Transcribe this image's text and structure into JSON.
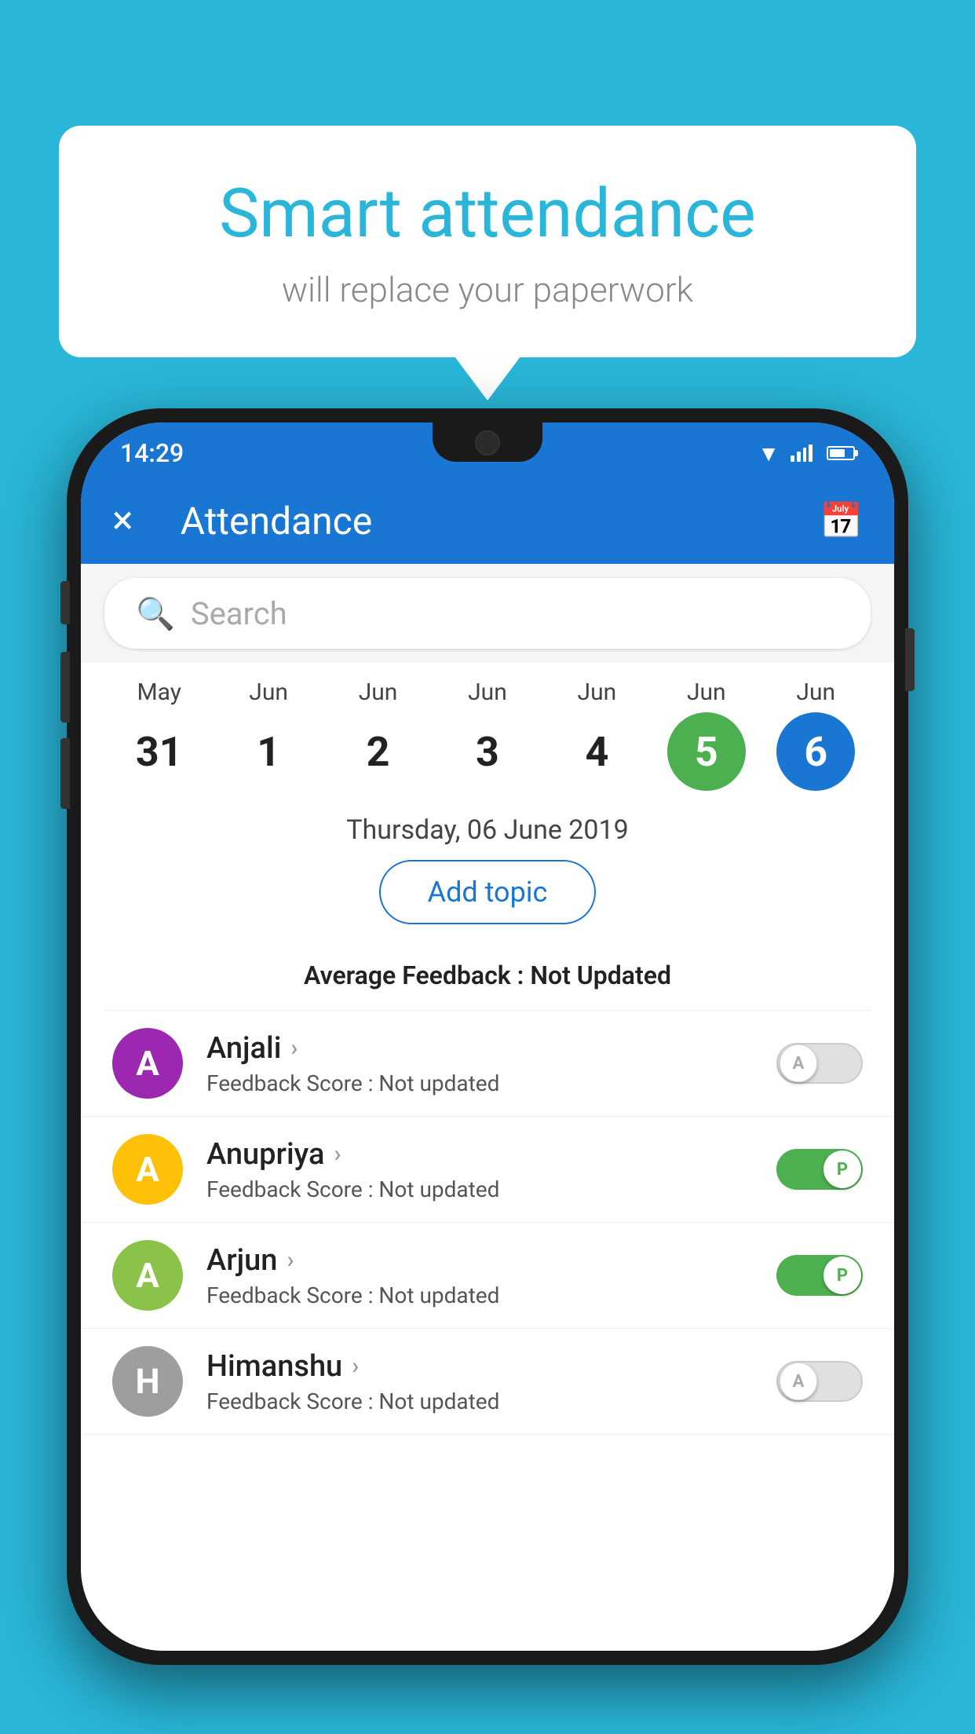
{
  "background_color": "#29b6d8",
  "bubble": {
    "title": "Smart attendance",
    "subtitle": "will replace your paperwork"
  },
  "status_bar": {
    "time": "14:29",
    "icons": [
      "wifi",
      "signal",
      "battery"
    ]
  },
  "app_bar": {
    "title": "Attendance",
    "close_label": "×",
    "calendar_icon": "📅"
  },
  "search": {
    "placeholder": "Search"
  },
  "calendar": {
    "columns": [
      {
        "month": "May",
        "date": "31",
        "style": "normal"
      },
      {
        "month": "Jun",
        "date": "1",
        "style": "normal"
      },
      {
        "month": "Jun",
        "date": "2",
        "style": "normal"
      },
      {
        "month": "Jun",
        "date": "3",
        "style": "normal"
      },
      {
        "month": "Jun",
        "date": "4",
        "style": "normal"
      },
      {
        "month": "Jun",
        "date": "5",
        "style": "today"
      },
      {
        "month": "Jun",
        "date": "6",
        "style": "selected"
      }
    ]
  },
  "date_full": "Thursday, 06 June 2019",
  "add_topic_label": "Add topic",
  "avg_feedback": {
    "label": "Average Feedback : ",
    "value": "Not Updated"
  },
  "students": [
    {
      "name": "Anjali",
      "avatar_letter": "A",
      "avatar_color": "#9c27b0",
      "feedback_label": "Feedback Score : ",
      "feedback_value": "Not updated",
      "toggle": "off",
      "toggle_letter": "A"
    },
    {
      "name": "Anupriya",
      "avatar_letter": "A",
      "avatar_color": "#ffc107",
      "feedback_label": "Feedback Score : ",
      "feedback_value": "Not updated",
      "toggle": "on",
      "toggle_letter": "P"
    },
    {
      "name": "Arjun",
      "avatar_letter": "A",
      "avatar_color": "#8bc34a",
      "feedback_label": "Feedback Score : ",
      "feedback_value": "Not updated",
      "toggle": "on",
      "toggle_letter": "P"
    },
    {
      "name": "Himanshu",
      "avatar_letter": "H",
      "avatar_color": "#9e9e9e",
      "feedback_label": "Feedback Score : ",
      "feedback_value": "Not updated",
      "toggle": "off",
      "toggle_letter": "A"
    }
  ]
}
